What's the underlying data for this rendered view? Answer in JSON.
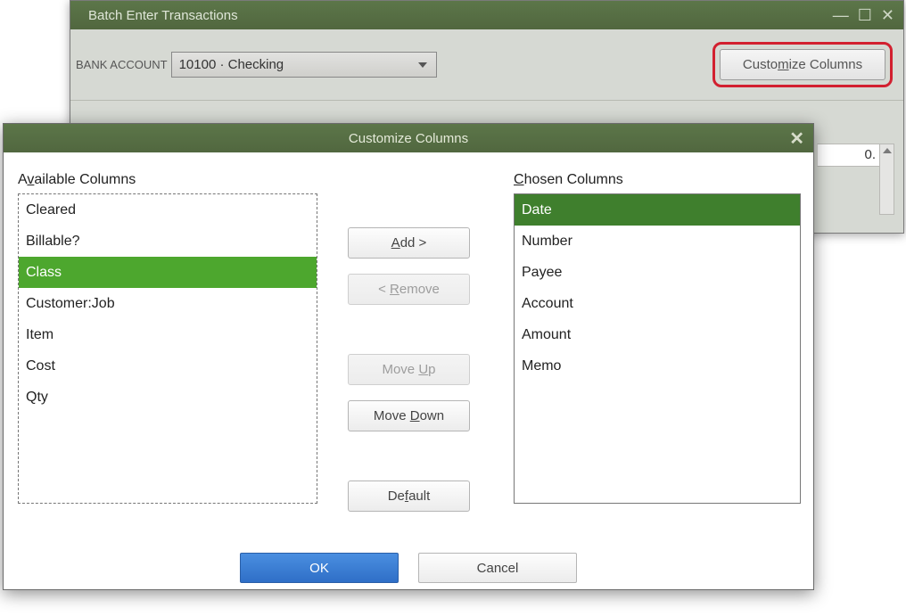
{
  "main_window": {
    "title": "Batch Enter Transactions",
    "bank_account_label": "BANK ACCOUNT",
    "bank_account_value": "10100 · Checking",
    "customize_button_prefix": "Custo",
    "customize_button_accel": "m",
    "customize_button_suffix": "ize Columns",
    "visible_cell_value": "0."
  },
  "dialog": {
    "title": "Customize Columns",
    "available_label_accel": "v",
    "available_label_prefix": "A",
    "available_label_suffix": "ailable Columns",
    "chosen_label_accel": "C",
    "chosen_label_suffix": "hosen Columns",
    "available_columns": [
      {
        "label": "Cleared",
        "selected": false
      },
      {
        "label": "Billable?",
        "selected": false
      },
      {
        "label": "Class",
        "selected": true
      },
      {
        "label": "Customer:Job",
        "selected": false
      },
      {
        "label": "Item",
        "selected": false
      },
      {
        "label": "Cost",
        "selected": false
      },
      {
        "label": "Qty",
        "selected": false
      }
    ],
    "chosen_columns": [
      {
        "label": "Date",
        "selected": true
      },
      {
        "label": "Number",
        "selected": false
      },
      {
        "label": "Payee",
        "selected": false
      },
      {
        "label": "Account",
        "selected": false
      },
      {
        "label": "Amount",
        "selected": false
      },
      {
        "label": "Memo",
        "selected": false
      }
    ],
    "buttons": {
      "add_accel": "A",
      "add_suffix": "dd >",
      "remove_prefix": "< ",
      "remove_accel": "R",
      "remove_suffix": "emove",
      "moveup_prefix": "Move ",
      "moveup_accel": "U",
      "moveup_suffix": "p",
      "movedown_prefix": "Move ",
      "movedown_accel": "D",
      "movedown_suffix": "own",
      "default_prefix": "De",
      "default_accel": "f",
      "default_suffix": "ault",
      "ok": "OK",
      "cancel": "Cancel"
    }
  }
}
